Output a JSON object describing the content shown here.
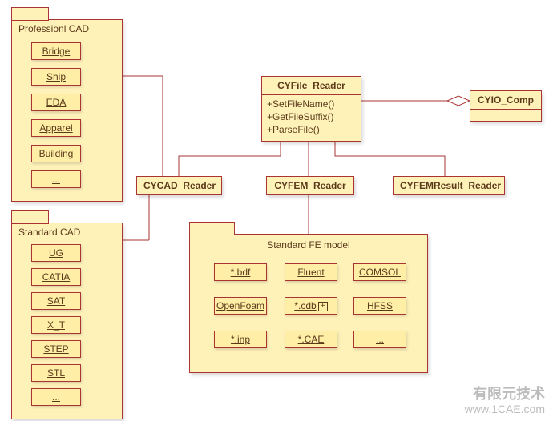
{
  "packages": {
    "prof_cad": {
      "title": "Professionl CAD",
      "items": [
        "Bridge",
        "Ship",
        "EDA",
        "Apparel",
        "Building",
        "..."
      ]
    },
    "std_cad": {
      "title": "Standard CAD",
      "items": [
        "UG",
        "CATIA",
        "SAT",
        "X_T",
        "STEP",
        "STL",
        "..."
      ]
    },
    "std_fe": {
      "title": "Standard FE model",
      "items": [
        "*.bdf",
        "Fluent",
        "COMSOL",
        "OpenFoam",
        "*.cdb",
        "HFSS",
        "*.inp",
        "*.CAE",
        "..."
      ]
    }
  },
  "classes": {
    "cyfile": {
      "name": "CYFile_Reader",
      "ops": [
        "+SetFileName()",
        "+GetFileSuffix()",
        "+ParseFile()"
      ]
    },
    "cyio": {
      "name": "CYIO_Comp"
    },
    "cycad": {
      "name": "CYCAD_Reader"
    },
    "cyfem": {
      "name": "CYFEM_Reader"
    },
    "cyfemresult": {
      "name": "CYFEMResult_Reader"
    }
  },
  "watermark": {
    "line1": "有限元技术",
    "line2": "www.1CAE.com"
  }
}
